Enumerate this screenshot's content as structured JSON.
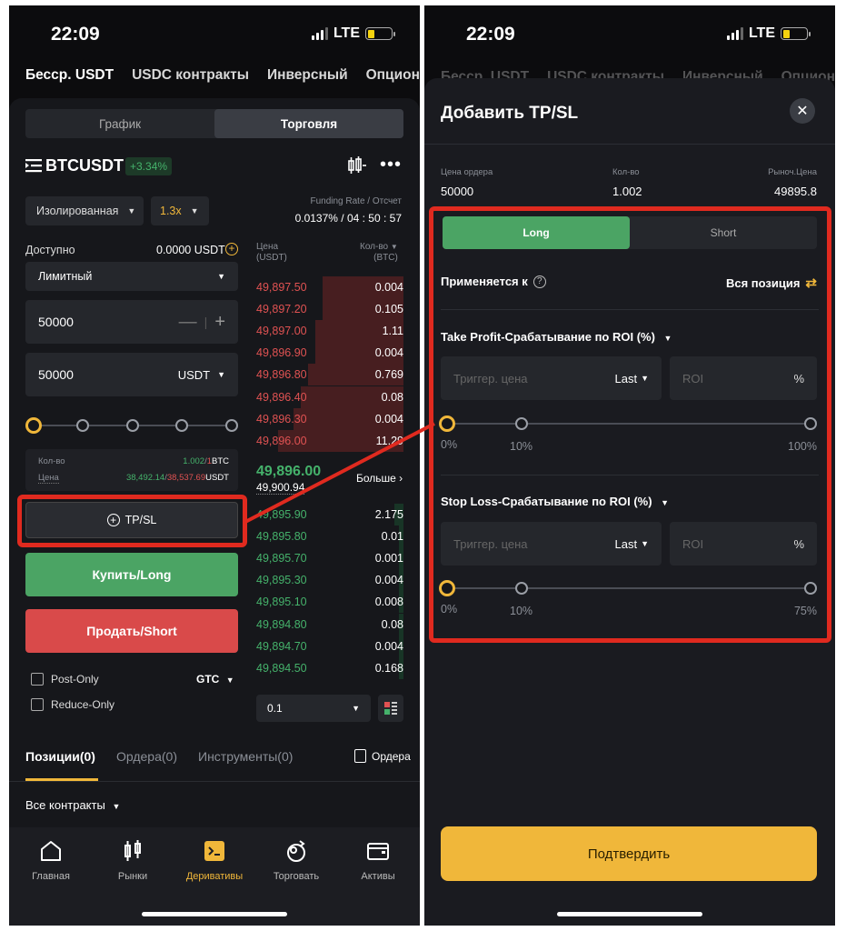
{
  "status": {
    "time": "22:09",
    "network": "LTE"
  },
  "topnav": [
    "Бесср. USDT",
    "USDC контракты",
    "Инверсный",
    "Опцион"
  ],
  "left": {
    "tabs": [
      "График",
      "Торговля"
    ],
    "symbol": "BTCUSDT",
    "change": "+3.34%",
    "margin_mode": "Изолированная",
    "leverage": "1.3x",
    "funding_label": "Funding Rate / Отсчет",
    "funding_value": "0.0137% / 04 : 50 : 57",
    "available_label": "Доступно",
    "available_value": "0.0000 USDT",
    "order_type": "Лимитный",
    "price_value": "50000",
    "amount_value": "50000",
    "amount_unit": "USDT",
    "qty_label": "Кол-во",
    "qty_green": "1.002",
    "qty_red": "1",
    "qty_unit": "BTC",
    "price_label": "Цена",
    "price_green": "38,492.14",
    "price_red": "38,537.69",
    "price_unit": "USDT",
    "tpsl_button": "TP/SL",
    "buy_button": "Купить/Long",
    "sell_button": "Продать/Short",
    "post_only": "Post-Only",
    "reduce_only": "Reduce-Only",
    "gtc": "GTC",
    "ob_price_header": "Цена",
    "ob_price_unit": "(USDT)",
    "ob_qty_header": "Кол-во",
    "ob_qty_unit": "(BTC)",
    "asks": [
      {
        "price": "49,897.50",
        "qty": "0.004"
      },
      {
        "price": "49,897.20",
        "qty": "0.105"
      },
      {
        "price": "49,897.00",
        "qty": "1.11"
      },
      {
        "price": "49,896.90",
        "qty": "0.004"
      },
      {
        "price": "49,896.80",
        "qty": "0.769"
      },
      {
        "price": "49,896.40",
        "qty": "0.08"
      },
      {
        "price": "49,896.30",
        "qty": "0.004"
      },
      {
        "price": "49,896.00",
        "qty": "11.29"
      }
    ],
    "mid_price": "49,896.00",
    "mark_price": "49,900.94",
    "more_label": "Больше",
    "bids": [
      {
        "price": "49,895.90",
        "qty": "2.175"
      },
      {
        "price": "49,895.80",
        "qty": "0.01"
      },
      {
        "price": "49,895.70",
        "qty": "0.001"
      },
      {
        "price": "49,895.30",
        "qty": "0.004"
      },
      {
        "price": "49,895.10",
        "qty": "0.008"
      },
      {
        "price": "49,894.80",
        "qty": "0.08"
      },
      {
        "price": "49,894.70",
        "qty": "0.004"
      },
      {
        "price": "49,894.50",
        "qty": "0.168"
      }
    ],
    "depth_value": "0.1",
    "pos_tabs": [
      "Позиции(0)",
      "Ордера(0)",
      "Инструменты(0)"
    ],
    "orders_link": "Ордера",
    "all_contracts": "Все контракты",
    "bottom_nav": [
      "Главная",
      "Рынки",
      "Деривативы",
      "Торговать",
      "Активы"
    ]
  },
  "right": {
    "title": "Добавить TP/SL",
    "order_price_label": "Цена ордера",
    "order_price": "50000",
    "qty_label": "Кол-во",
    "qty": "1.002",
    "market_label": "Рыноч.Цена",
    "market": "49895.8",
    "tab_long": "Long",
    "tab_short": "Short",
    "applies_label": "Применяется к",
    "applies_value": "Вся позиция",
    "tp_title": "Take Profit-Срабатывание по ROI (%)",
    "sl_title": "Stop Loss-Срабатывание по ROI (%)",
    "trigger_placeholder": "Триггер. цена",
    "last_label": "Last",
    "roi_placeholder": "ROI",
    "percent": "%",
    "tp_ticks": [
      "0%",
      "10%",
      "100%"
    ],
    "sl_ticks": [
      "0%",
      "10%",
      "75%"
    ],
    "confirm": "Подтвердить"
  },
  "colors": {
    "accent": "#f0b73a",
    "green": "#45b26b",
    "red": "#e05252",
    "frame": "#e02a1f"
  }
}
